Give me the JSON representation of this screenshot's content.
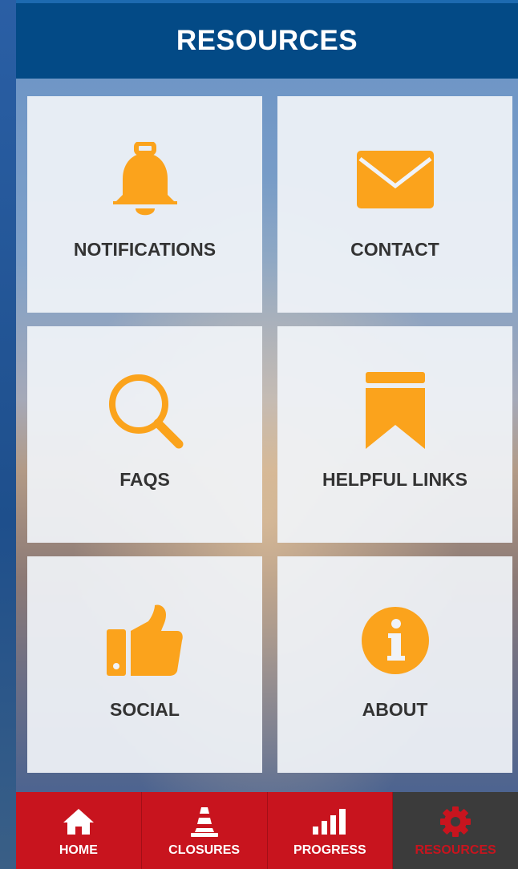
{
  "header": {
    "title": "RESOURCES"
  },
  "tiles": [
    {
      "label": "NOTIFICATIONS",
      "icon": "bell-icon"
    },
    {
      "label": "CONTACT",
      "icon": "envelope-icon"
    },
    {
      "label": "FAQS",
      "icon": "search-icon"
    },
    {
      "label": "HELPFUL LINKS",
      "icon": "bookmark-icon"
    },
    {
      "label": "SOCIAL",
      "icon": "thumbs-up-icon"
    },
    {
      "label": "ABOUT",
      "icon": "info-icon"
    }
  ],
  "tabs": [
    {
      "label": "HOME",
      "icon": "home-icon"
    },
    {
      "label": "CLOSURES",
      "icon": "traffic-cone-icon"
    },
    {
      "label": "PROGRESS",
      "icon": "bar-chart-icon"
    },
    {
      "label": "RESOURCES",
      "icon": "gear-icon",
      "active": true
    }
  ],
  "colors": {
    "header": "#034a86",
    "accent_orange": "#fba31c",
    "tabbar_red": "#c8141e",
    "tabbar_active": "#3b3b3b",
    "label_text": "#333333"
  }
}
